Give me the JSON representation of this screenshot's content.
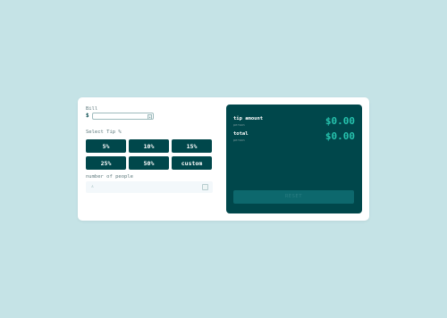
{
  "bill": {
    "label": "Bill",
    "currency": "$",
    "value": ""
  },
  "tip": {
    "label": "Select Tip %",
    "options": [
      "5%",
      "10%",
      "15%",
      "25%",
      "50%"
    ],
    "custom_label": "custom"
  },
  "people": {
    "label": "number of people",
    "value": ""
  },
  "results": {
    "tip_amount": {
      "title": "tip amount",
      "sub": "person",
      "value": "$0.00"
    },
    "total": {
      "title": "total",
      "sub": "person",
      "value": "$0.00"
    },
    "reset_label": "RESET"
  },
  "colors": {
    "page_bg": "#c5e3e6",
    "dark": "#00474b",
    "accent": "#26c2ad"
  },
  "icons": {
    "person": "person-icon"
  }
}
